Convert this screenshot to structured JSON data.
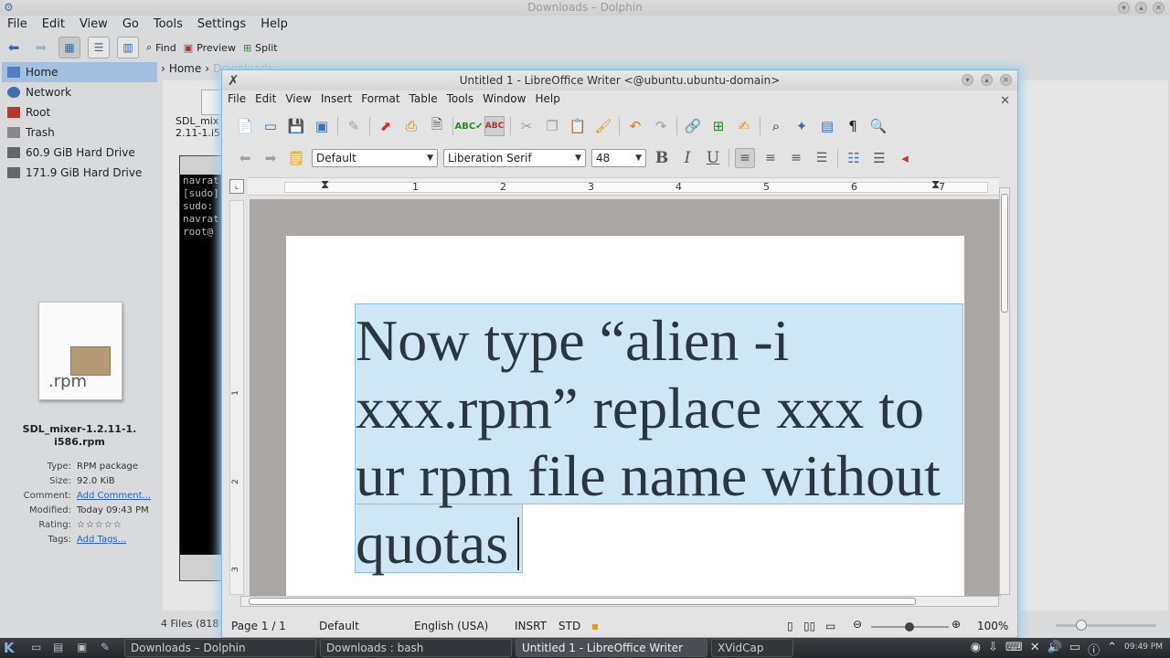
{
  "dolphin": {
    "title": "Downloads – Dolphin",
    "menu": [
      "File",
      "Edit",
      "View",
      "Go",
      "Tools",
      "Settings",
      "Help"
    ],
    "toolbar": {
      "find": "Find",
      "preview": "Preview",
      "split": "Split"
    },
    "places": [
      {
        "label": "Home",
        "icon": "home-icon",
        "selected": true
      },
      {
        "label": "Network",
        "icon": "network-icon"
      },
      {
        "label": "Root",
        "icon": "folder-icon"
      },
      {
        "label": "Trash",
        "icon": "trash-icon"
      },
      {
        "label": "60.9 GiB Hard Drive",
        "icon": "drive-icon"
      },
      {
        "label": "171.9 GiB Hard Drive",
        "icon": "drive-icon"
      }
    ],
    "breadcrumb": {
      "home": "Home",
      "current": "Downloads"
    },
    "grid_file": {
      "line1": "SDL_mix",
      "line2": "2.11-1.i5"
    },
    "info_panel": {
      "icon_ext": ".rpm",
      "filename_line1": "SDL_mixer-1.2.11-1.",
      "filename_line2": "i586.rpm",
      "props": [
        {
          "key": "Type:",
          "value": "RPM package",
          "link": false
        },
        {
          "key": "Size:",
          "value": "92.0 KiB",
          "link": false
        },
        {
          "key": "Comment:",
          "value": "Add Comment...",
          "link": true
        },
        {
          "key": "Modified:",
          "value": "Today 09:43 PM",
          "link": false
        },
        {
          "key": "Rating:",
          "value": "☆☆☆☆☆",
          "link": false
        },
        {
          "key": "Tags:",
          "value": "Add Tags...",
          "link": true
        }
      ]
    },
    "status": "4 Files (818"
  },
  "terminal": {
    "lines": [
      "navrat",
      "[sudo]",
      "sudo:",
      "navrat",
      "root@"
    ]
  },
  "writer": {
    "title": "Untitled 1 - LibreOffice Writer <@ubuntu.ubuntu-domain>",
    "menu": [
      "File",
      "Edit",
      "View",
      "Insert",
      "Format",
      "Table",
      "Tools",
      "Window",
      "Help"
    ],
    "paragraph_style": "Default",
    "font_name": "Liberation Serif",
    "font_size": "48",
    "ruler_numbers": [
      "1",
      "2",
      "3",
      "4",
      "5",
      "6",
      "7"
    ],
    "vruler_numbers": [
      "1",
      "2",
      "3"
    ],
    "body_text": "Now type “alien -i xxx.rpm” replace xxx to ur rpm file name without quotas",
    "status": {
      "page": "Page 1 / 1",
      "style": "Default",
      "language": "English (USA)",
      "insert_mode": "INSRT",
      "selection_mode": "STD",
      "zoom": "100%"
    }
  },
  "taskbar": {
    "tasks": [
      {
        "label": "Downloads – Dolphin",
        "active": false
      },
      {
        "label": "Downloads : bash",
        "active": false
      },
      {
        "label": "Untitled 1 - LibreOffice Writer",
        "active": true
      },
      {
        "label": "XVidCap",
        "active": false
      }
    ],
    "clock": "09:49 PM"
  },
  "colors": {
    "selection": "#cfe6f4",
    "window_glow": "#9ad0ee",
    "link": "#2e62b8"
  }
}
